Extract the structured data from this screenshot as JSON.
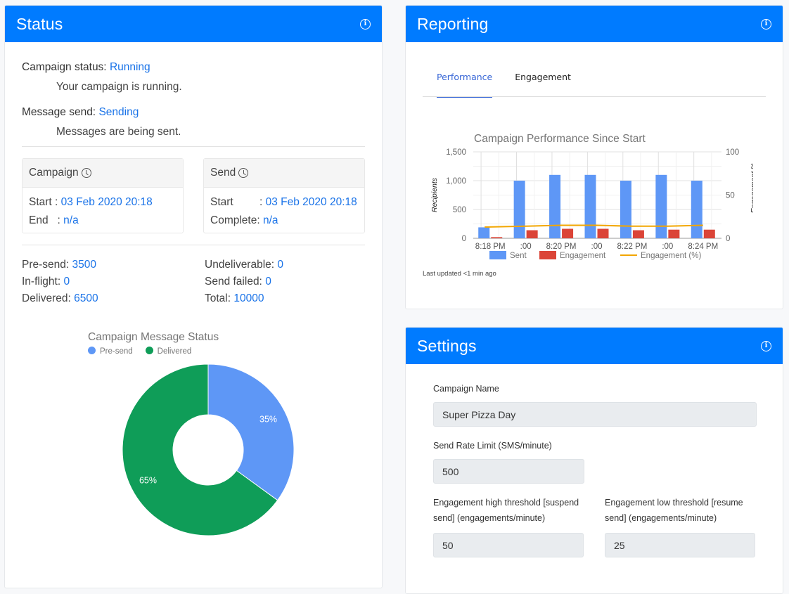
{
  "colors": {
    "header": "#007bff",
    "link": "#1a73e8",
    "sent": "#5e97f6",
    "engagement": "#db4437",
    "engagement_pct": "#f2a600",
    "delivered": "#0f9d58",
    "tab_active": "#3766d6"
  },
  "status": {
    "title": "Status",
    "info_icon": "info-icon",
    "campaign_status_label": "Campaign status:",
    "campaign_status_value": "Running",
    "campaign_status_desc": "Your campaign is running.",
    "message_send_label": "Message send:",
    "message_send_value": "Sending",
    "message_send_desc": "Messages are being sent.",
    "campaign_box": {
      "title": "Campaign",
      "icon": "clock-icon",
      "rows": [
        {
          "key": "Start",
          "sep": " : ",
          "value": "03 Feb 2020 20:18"
        },
        {
          "key": "End",
          "sep": "   : ",
          "value": "n/a"
        }
      ]
    },
    "send_box": {
      "title": "Send",
      "icon": "clock-icon",
      "rows": [
        {
          "key": "Start",
          "sep": " : ",
          "value": "03 Feb 2020 20:18"
        },
        {
          "key": "Complete",
          "sep": " : ",
          "value": "n/a"
        }
      ]
    },
    "counts": [
      {
        "label": "Pre-send:",
        "value": "3500"
      },
      {
        "label": "Undeliverable:",
        "value": "0"
      },
      {
        "label": "In-flight:",
        "value": "0"
      },
      {
        "label": "Send failed:",
        "value": "0"
      },
      {
        "label": "Delivered:",
        "value": "6500"
      },
      {
        "label": "Total:",
        "value": "10000"
      }
    ]
  },
  "reporting": {
    "title": "Reporting",
    "tabs": [
      {
        "label": "Performance",
        "active": true
      },
      {
        "label": "Engagement",
        "active": false
      }
    ],
    "last_updated": "Last updated <1 min ago"
  },
  "settings": {
    "title": "Settings",
    "campaign_name_label": "Campaign Name",
    "campaign_name_value": "Super Pizza Day",
    "send_rate_label": "Send Rate Limit (SMS/minute)",
    "send_rate_value": "500",
    "high_threshold_label": "Engagement high threshold [suspend send] (engagements/minute)",
    "high_threshold_value": "50",
    "low_threshold_label": "Engagement low threshold [resume send] (engagements/minute)",
    "low_threshold_value": "25"
  },
  "chart_data": [
    {
      "type": "pie",
      "title": "Campaign Message Status",
      "legend": "top-left",
      "categories": [
        "Pre-send",
        "Delivered"
      ],
      "values": [
        3500,
        6500
      ],
      "labels": [
        "35%",
        "65%"
      ],
      "donut": true
    },
    {
      "type": "bar",
      "title": "Campaign Performance Since Start",
      "categories": [
        "8:18 PM",
        ":00",
        "8:20 PM",
        ":00",
        "8:22 PM",
        ":00",
        "8:24 PM"
      ],
      "series": [
        {
          "name": "Sent",
          "kind": "bar",
          "axis": "left",
          "values": [
            190,
            1000,
            1100,
            1100,
            1000,
            1100,
            1000
          ]
        },
        {
          "name": "Engagement",
          "kind": "bar",
          "axis": "left",
          "values": [
            20,
            140,
            165,
            165,
            140,
            150,
            150
          ]
        },
        {
          "name": "Engagement (%)",
          "kind": "line",
          "axis": "right",
          "values": [
            13,
            14,
            15,
            15,
            14,
            14,
            15
          ]
        }
      ],
      "ylabel": "Recipients",
      "ylabel_right": "Engagement %",
      "ylim": [
        0,
        1500
      ],
      "yticks": [
        "0",
        "500",
        "1,000",
        "1,500"
      ],
      "ylim_right": [
        0,
        100
      ],
      "yticks_right": [
        "0",
        "50",
        "100"
      ],
      "grid": true,
      "legend": "bottom"
    }
  ]
}
